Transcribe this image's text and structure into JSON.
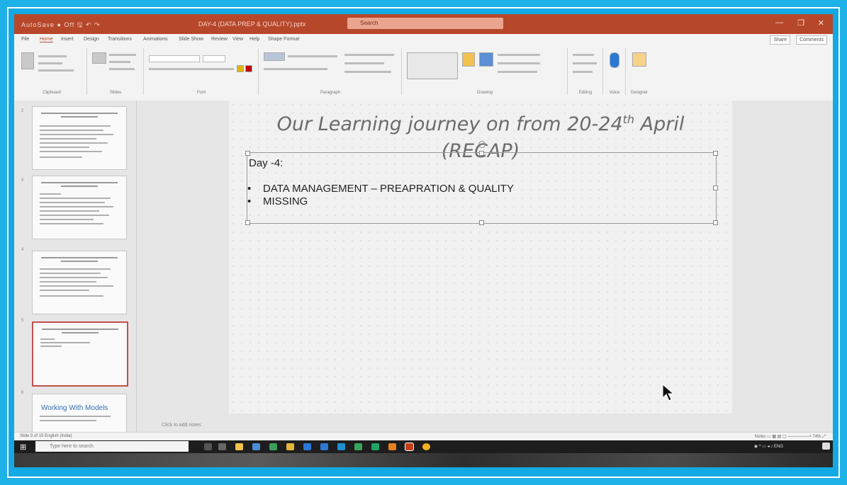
{
  "titlebar": {
    "quick_access": "AutoSave ● Off  🖫  ↶ ↷",
    "document_title": "DAY-4 (DATA PREP & QUALITY).pptx",
    "search_placeholder": "Search",
    "user": "",
    "minimize": "—",
    "restore": "❐",
    "close": "✕"
  },
  "menu": {
    "tabs": [
      "File",
      "Home",
      "Insert",
      "Design",
      "Transitions",
      "Animations",
      "Slide Show",
      "Review",
      "View",
      "Help",
      "Shape Format"
    ],
    "active_tab": "Home",
    "share": "Share",
    "comments": "Comments"
  },
  "ribbon": {
    "groups": [
      "Clipboard",
      "Slides",
      "Font",
      "Paragraph",
      "Drawing",
      "Editing",
      "Voice",
      "Designer"
    ]
  },
  "thumbnails": {
    "numbers": [
      "2",
      "3",
      "4",
      "5",
      "6"
    ],
    "last_title": "Working With Models"
  },
  "slide": {
    "title_main": "Our Learning journey on from 20-24",
    "title_sup": "th",
    "title_tail": " April",
    "title_line2": "(RECAP)",
    "day_label": "Day -4:",
    "bullets": [
      "DATA MANAGEMENT – PREAPRATION & QUALITY",
      "MISSING"
    ],
    "bullet_char": "•"
  },
  "notes": {
    "placeholder": "Click to add notes"
  },
  "statusbar": {
    "left": "Slide 5 of 15    English (India)",
    "right": "Notes   ▭  ▦  ▤  ▢   —————+   74%  ⤢"
  },
  "taskbar": {
    "search_placeholder": "Type here to search",
    "clock_time": "",
    "clock_date": ""
  }
}
